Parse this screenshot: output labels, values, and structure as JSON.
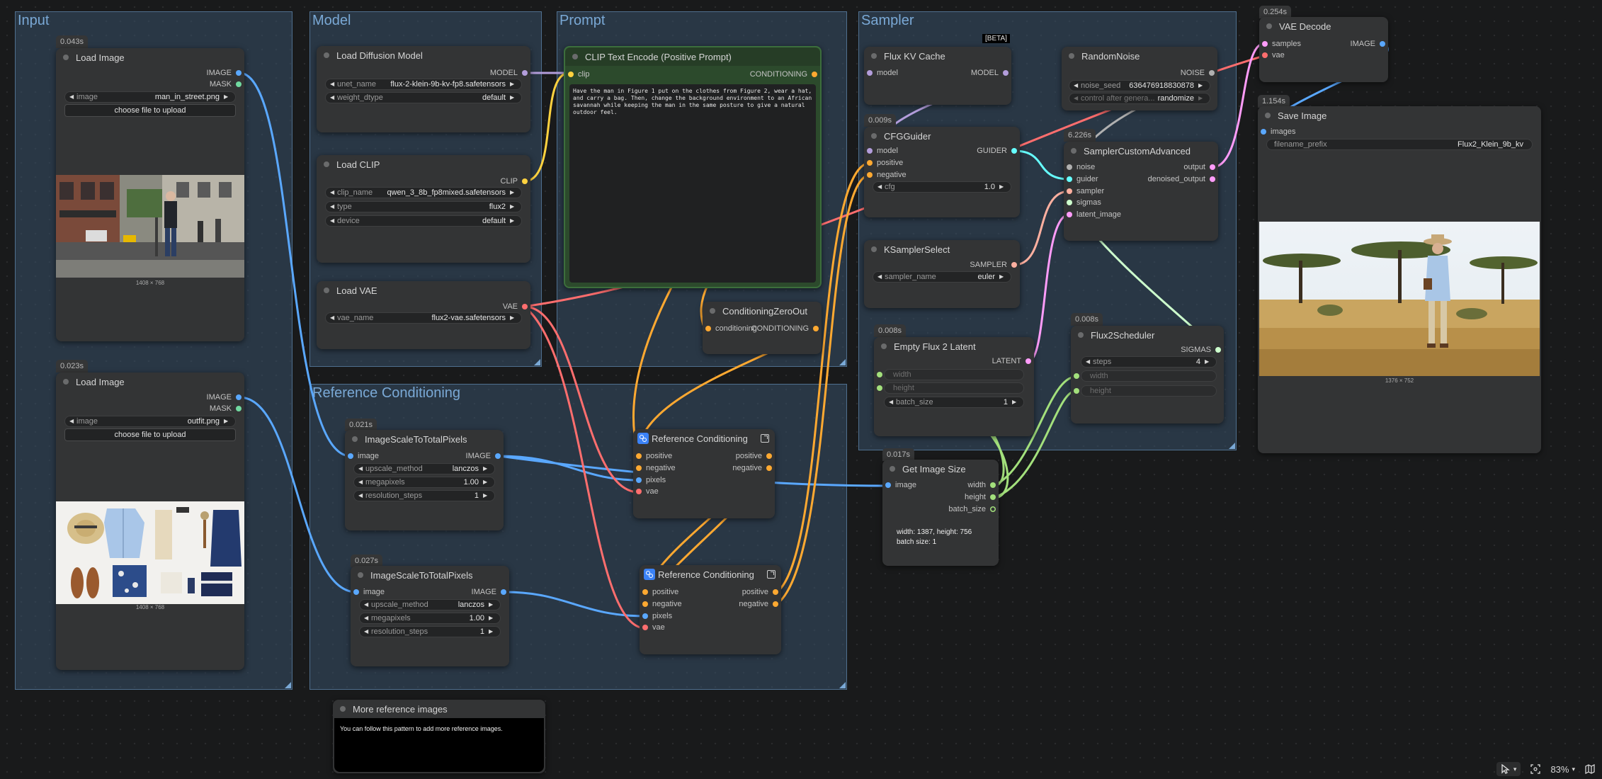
{
  "groups": {
    "input": "Input",
    "model": "Model",
    "prompt": "Prompt",
    "sampler": "Sampler",
    "reference": "Reference Conditioning"
  },
  "colors": {
    "image": "#5aa8ff",
    "mask": "#71d9a0",
    "model": "#b39ddb",
    "clip": "#ffd23f",
    "conditioning": "#ffa931",
    "vae": "#ff6e6e",
    "latent": "#ff9cf9",
    "noise": "#b0b0b0",
    "guider": "#66ffff",
    "sampler": "#ffb0a0",
    "sigmas": "#cdffcd",
    "int": "#a3e07c",
    "prompt_node": "#2c4a2c"
  },
  "nodes": {
    "load_image_1": {
      "timing": "0.043s",
      "title": "Load Image",
      "out_image": "IMAGE",
      "out_mask": "MASK",
      "image_label": "image",
      "image_value": "man_in_street.png",
      "upload_label": "choose file to upload",
      "caption": "1408 × 768"
    },
    "load_image_2": {
      "timing": "0.023s",
      "title": "Load Image",
      "out_image": "IMAGE",
      "out_mask": "MASK",
      "image_label": "image",
      "image_value": "outfit.png",
      "upload_label": "choose file to upload",
      "caption": "1408 × 768"
    },
    "load_diffusion": {
      "title": "Load Diffusion Model",
      "out_model": "MODEL",
      "unet_label": "unet_name",
      "unet_value": "flux-2-klein-9b-kv-fp8.safetensors",
      "dtype_label": "weight_dtype",
      "dtype_value": "default"
    },
    "load_clip": {
      "title": "Load CLIP",
      "out_clip": "CLIP",
      "clip_label": "clip_name",
      "clip_value": "qwen_3_8b_fp8mixed.safetensors",
      "type_label": "type",
      "type_value": "flux2",
      "device_label": "device",
      "device_value": "default"
    },
    "load_vae": {
      "title": "Load VAE",
      "out_vae": "VAE",
      "vae_label": "vae_name",
      "vae_value": "flux2-vae.safetensors"
    },
    "clip_text": {
      "title": "CLIP Text Encode (Positive Prompt)",
      "in_clip": "clip",
      "out_cond": "CONDITIONING",
      "text": "Have the man in Figure 1 put on the clothes from Figure 2, wear a hat, and carry a bag. Then, change the background environment to an African savannah while keeping the man in the same posture to give a natural outdoor feel."
    },
    "cond_zero": {
      "title": "ConditioningZeroOut",
      "in_cond": "conditioning",
      "out_cond": "CONDITIONING"
    },
    "flux_kv": {
      "title": "Flux KV Cache",
      "beta": "[BETA]",
      "in_model": "model",
      "out_model": "MODEL"
    },
    "cfg_guider": {
      "timing": "0.009s",
      "title": "CFGGuider",
      "in_model": "model",
      "in_pos": "positive",
      "in_neg": "negative",
      "out_guider": "GUIDER",
      "cfg_label": "cfg",
      "cfg_value": "1.0"
    },
    "random_noise": {
      "title": "RandomNoise",
      "out_noise": "NOISE",
      "seed_label": "noise_seed",
      "seed_value": "636476918830878",
      "control_label": "control after genera...",
      "control_value": "randomize"
    },
    "sampler_custom": {
      "timing": "6.226s",
      "title": "SamplerCustomAdvanced",
      "in_noise": "noise",
      "in_guider": "guider",
      "in_sampler": "sampler",
      "in_sigmas": "sigmas",
      "in_latent": "latent_image",
      "out_output": "output",
      "out_denoised": "denoised_output"
    },
    "ksampler_select": {
      "title": "KSamplerSelect",
      "out_sampler": "SAMPLER",
      "name_label": "sampler_name",
      "name_value": "euler"
    },
    "empty_latent": {
      "timing": "0.008s",
      "title": "Empty Flux 2 Latent",
      "out_latent": "LATENT",
      "width_label": "width",
      "height_label": "height",
      "batch_label": "batch_size",
      "batch_value": "1"
    },
    "flux2_scheduler": {
      "timing": "0.008s",
      "title": "Flux2Scheduler",
      "out_sigmas": "SIGMAS",
      "steps_label": "steps",
      "steps_value": "4",
      "width_label": "width",
      "height_label": "height"
    },
    "vae_decode": {
      "timing": "0.254s",
      "title": "VAE Decode",
      "in_samples": "samples",
      "in_vae": "vae",
      "out_image": "IMAGE"
    },
    "save_image": {
      "timing": "1.154s",
      "title": "Save Image",
      "in_images": "images",
      "prefix_label": "filename_prefix",
      "prefix_value": "Flux2_Klein_9b_kv",
      "caption": "1376 × 752"
    },
    "scale_1": {
      "timing": "0.021s",
      "title": "ImageScaleToTotalPixels",
      "in_image": "image",
      "out_image": "IMAGE",
      "method_label": "upscale_method",
      "method_value": "lanczos",
      "mp_label": "megapixels",
      "mp_value": "1.00",
      "steps_label": "resolution_steps",
      "steps_value": "1"
    },
    "scale_2": {
      "timing": "0.027s",
      "title": "ImageScaleToTotalPixels",
      "in_image": "image",
      "out_image": "IMAGE",
      "method_label": "upscale_method",
      "method_value": "lanczos",
      "mp_label": "megapixels",
      "mp_value": "1.00",
      "steps_label": "resolution_steps",
      "steps_value": "1"
    },
    "ref_cond_1": {
      "title": "Reference Conditioning",
      "in_pos": "positive",
      "in_neg": "negative",
      "in_pixels": "pixels",
      "in_vae": "vae",
      "out_pos": "positive",
      "out_neg": "negative"
    },
    "ref_cond_2": {
      "title": "Reference Conditioning",
      "in_pos": "positive",
      "in_neg": "negative",
      "in_pixels": "pixels",
      "in_vae": "vae",
      "out_pos": "positive",
      "out_neg": "negative"
    },
    "get_size": {
      "timing": "0.017s",
      "title": "Get Image Size",
      "in_image": "image",
      "out_width": "width",
      "out_height": "height",
      "out_batch": "batch_size",
      "info_line1": "width: 1387, height: 756",
      "info_line2": "batch size: 1"
    },
    "more_refs": {
      "title": "More reference images",
      "note": "You can follow this pattern to add more reference images."
    }
  },
  "bottom_bar": {
    "zoom": "83%"
  }
}
